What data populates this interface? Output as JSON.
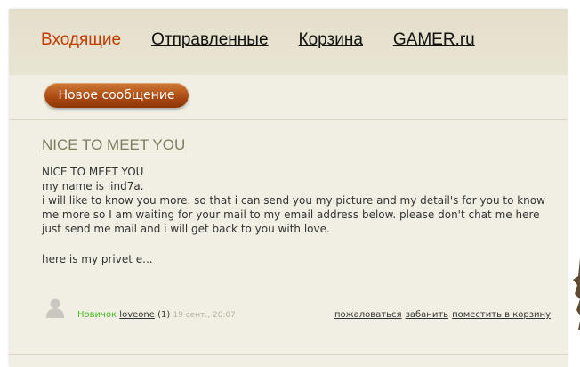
{
  "nav": {
    "tabs": [
      {
        "label": "Входящие"
      },
      {
        "label": "Отправленные"
      },
      {
        "label": "Корзина"
      },
      {
        "label": "GAMER.ru"
      }
    ]
  },
  "new_message_button": {
    "label": "Новое сообщение"
  },
  "message": {
    "title": "NICE TO MEET YOU",
    "body": [
      "NICE TO MEET YOU",
      "my name is lind7a.",
      "i will like to know you more. so that i can send you my picture and my detail's for you to know me more so I am waiting for your mail to my email address below. please don't chat me here just send me mail and i will get back to you with love."
    ],
    "preview": "here is my privet e...",
    "author": {
      "rank": "Новичок",
      "username": "loveone",
      "count": "(1)",
      "date": "19 сент., 20:07"
    },
    "actions": {
      "report": "пожаловаться",
      "ban": "забанить",
      "to_trash": "поместить в корзину"
    }
  },
  "colors": {
    "active_tab": "#c23b00",
    "button": "#a94912",
    "rank": "#44bb22",
    "title": "#7f7c62"
  }
}
